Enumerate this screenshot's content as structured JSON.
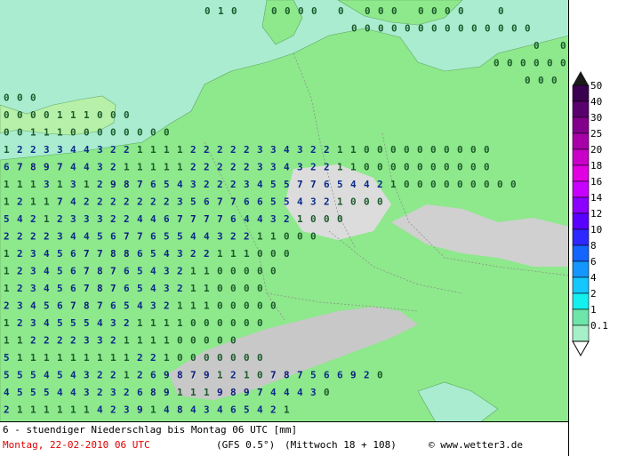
{
  "footer": {
    "title": "6 - stuendiger Niederschlag bis Montag 06 UTC [mm]",
    "date": "Montag, 22-02-2010  06 UTC",
    "model": "(GFS 0.5°)",
    "run": "(Mittwoch 18 + 108)",
    "credit": "© www.wetter3.de"
  },
  "legend": {
    "labels": [
      "50",
      "40",
      "30",
      "25",
      "20",
      "18",
      "16",
      "14",
      "12",
      "10",
      "8",
      "6",
      "4",
      "2",
      "1",
      "0.1"
    ],
    "colors": [
      "#3a0050",
      "#5a006e",
      "#82008c",
      "#a800a8",
      "#c800c8",
      "#e100e1",
      "#c800ff",
      "#8c00ff",
      "#5a00ff",
      "#2d28ff",
      "#1464ff",
      "#1496ff",
      "#14c8ff",
      "#14f0f0",
      "#6ee6aa",
      "#a5f0c8"
    ]
  },
  "map_colors": {
    "sea": "#a9ecd0",
    "land": "#8ee88c",
    "alps": "#b8b8b8"
  },
  "precip_rows": [
    {
      "r": 0,
      "c": "010  0000 0 000 0000  0"
    },
    {
      "r": 1,
      "c": "         00000000000000"
    },
    {
      "r": 2,
      "c": "                    0 000000000"
    },
    {
      "r": 3,
      "c": "               0000000000000"
    },
    {
      "r": 4,
      "c": "              000 0000000"
    },
    {
      "r": 5,
      "c": "000"
    },
    {
      "r": 6,
      "c": "0000111000"
    },
    {
      "r": 7,
      "c": "0011100000000"
    },
    {
      "r": 8,
      "c": "1223344322111122222334322110000000000"
    },
    {
      "r": 9,
      "c": "6789744321111122222334322110000000000"
    },
    {
      "r": 10,
      "c": "111313129876543222345577654421000000000"
    },
    {
      "r": 11,
      "c": "12117422222223567766554321000"
    },
    {
      "r": 12,
      "c": "54212333224467777644321000"
    },
    {
      "r": 13,
      "c": "222234456776554432211000"
    },
    {
      "r": 14,
      "c": "1234567788654322111000"
    },
    {
      "r": 15,
      "c": "123456787654321100000"
    },
    {
      "r": 16,
      "c": "12345678765432110000"
    },
    {
      "r": 17,
      "c": "234567876543211100000"
    },
    {
      "r": 18,
      "c": "12345554321111000000"
    },
    {
      "r": 19,
      "c": "112222332111100000"
    },
    {
      "r": 20,
      "c": "51111111112210000000"
    },
    {
      "r": 21,
      "c": "55545432212698791210787566920"
    },
    {
      "r": 22,
      "c": "4555443232689111989744430"
    },
    {
      "r": 23,
      "c": "2111111423914843465421"
    }
  ]
}
